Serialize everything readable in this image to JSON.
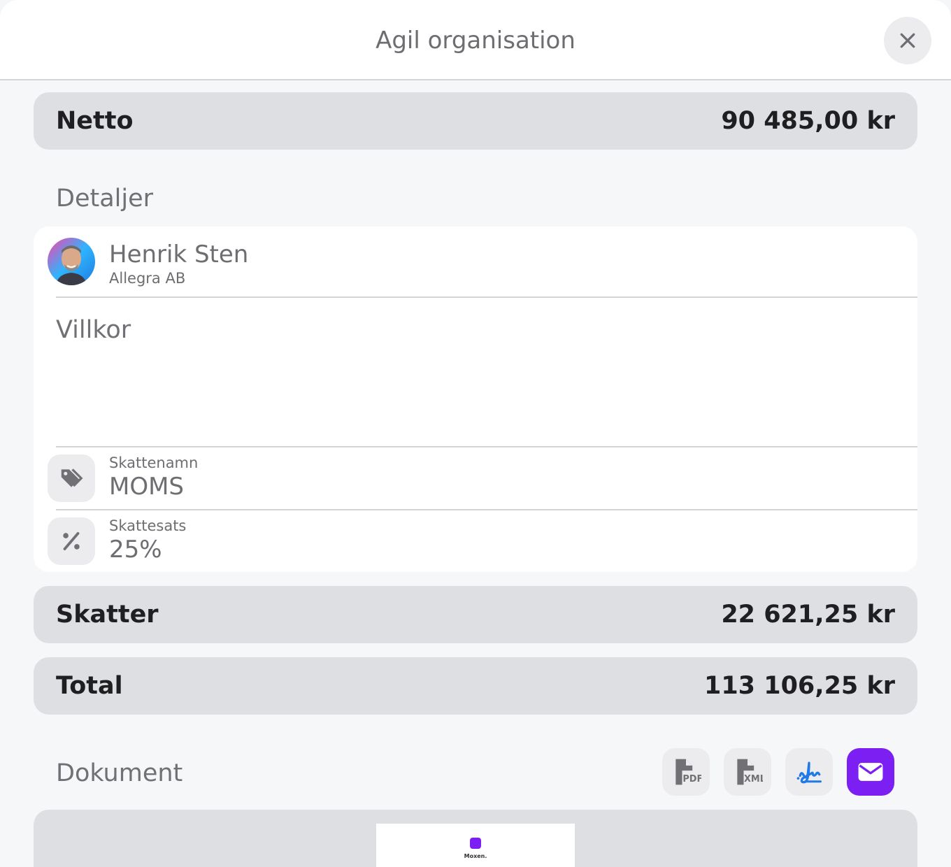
{
  "header": {
    "title": "Agil organisation",
    "close_icon": "close-icon"
  },
  "summary": {
    "net": {
      "label": "Netto",
      "amount": "90 485,00 kr"
    },
    "taxes": {
      "label": "Skatter",
      "amount": "22 621,25 kr"
    },
    "total": {
      "label": "Total",
      "amount": "113 106,25 kr"
    }
  },
  "details": {
    "title": "Detaljer",
    "contact": {
      "name": "Henrik Sten",
      "company": "Allegra AB"
    },
    "terms_label": "Villkor",
    "tax_name": {
      "label": "Skattenamn",
      "value": "MOMS",
      "icon": "tag-icon"
    },
    "tax_rate": {
      "label": "Skattesats",
      "value": "25%",
      "icon": "percent-icon"
    }
  },
  "documents": {
    "title": "Dokument",
    "actions": [
      {
        "name": "pdf",
        "icon": "pdf-file-icon"
      },
      {
        "name": "xml",
        "icon": "xml-file-icon"
      },
      {
        "name": "signature",
        "icon": "signature-icon"
      },
      {
        "name": "email",
        "icon": "envelope-icon"
      }
    ],
    "preview_brand": "Moxen."
  },
  "colors": {
    "accent": "#7b1ff2",
    "signature": "#1f7ae6",
    "pill": "#dedfe2"
  }
}
